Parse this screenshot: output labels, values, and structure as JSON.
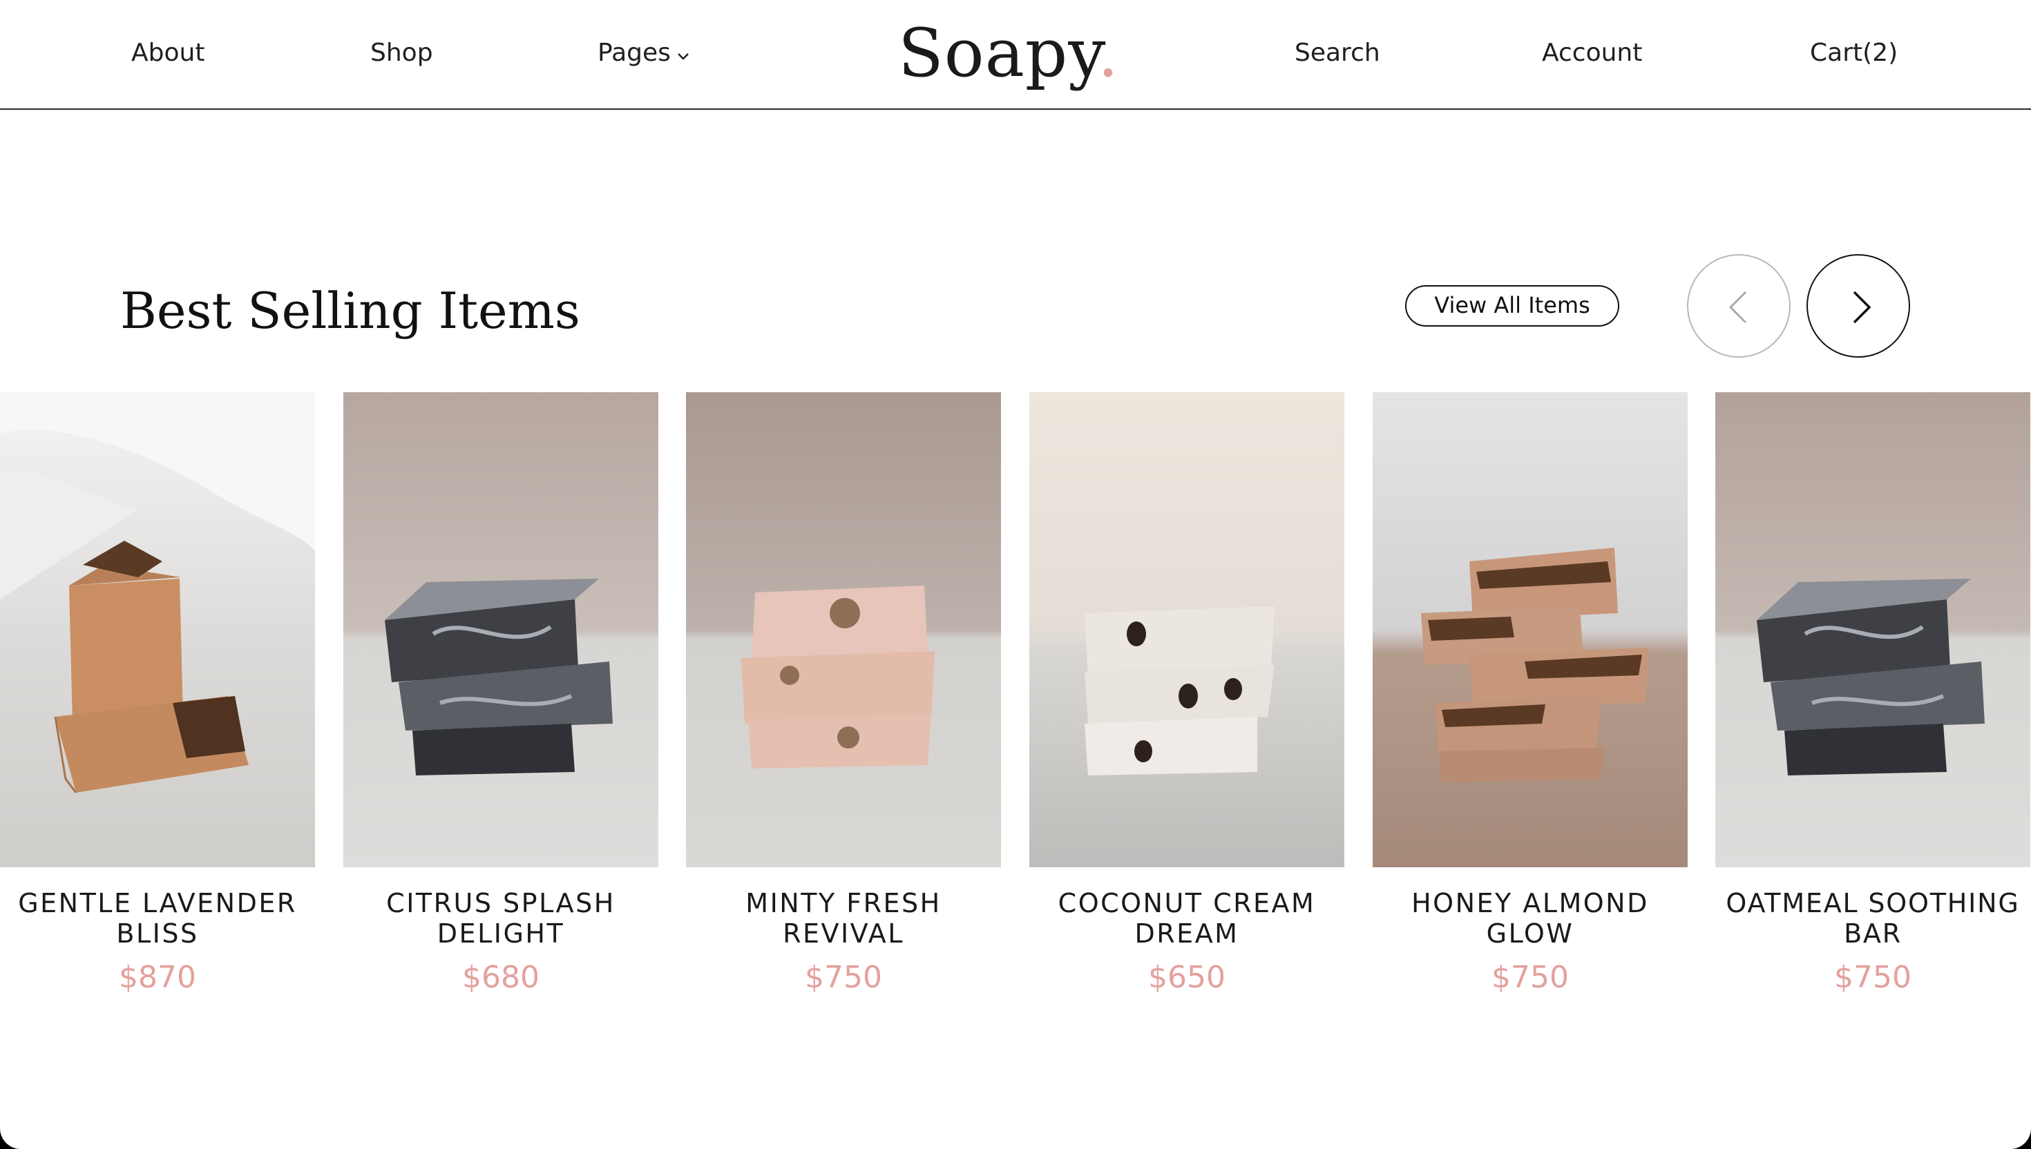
{
  "nav": {
    "left_links": [
      "About",
      "Shop",
      "Pages"
    ],
    "right_links": [
      "Search",
      "Account",
      "Cart(2)"
    ],
    "logo_text": "Soapy",
    "logo_dot": "."
  },
  "section": {
    "title": "Best Selling Items",
    "view_all_label": "View All Items",
    "prev_icon": "chevron-left-icon",
    "next_icon": "chevron-right-icon"
  },
  "products": [
    {
      "name": "Gentle Lavender Bliss",
      "price": "$870"
    },
    {
      "name": "Citrus Splash Delight",
      "price": "$680"
    },
    {
      "name": "Minty Fresh Revival",
      "price": "$750"
    },
    {
      "name": "Coconut Cream Dream",
      "price": "$650"
    },
    {
      "name": "Honey Almond Glow",
      "price": "$750"
    },
    {
      "name": "Oatmeal Soothing Bar",
      "price": "$750"
    }
  ],
  "colors": {
    "accent_pink": "#e3a19d",
    "text_dark": "#1a1a1a",
    "border": "#2a2a2a"
  }
}
